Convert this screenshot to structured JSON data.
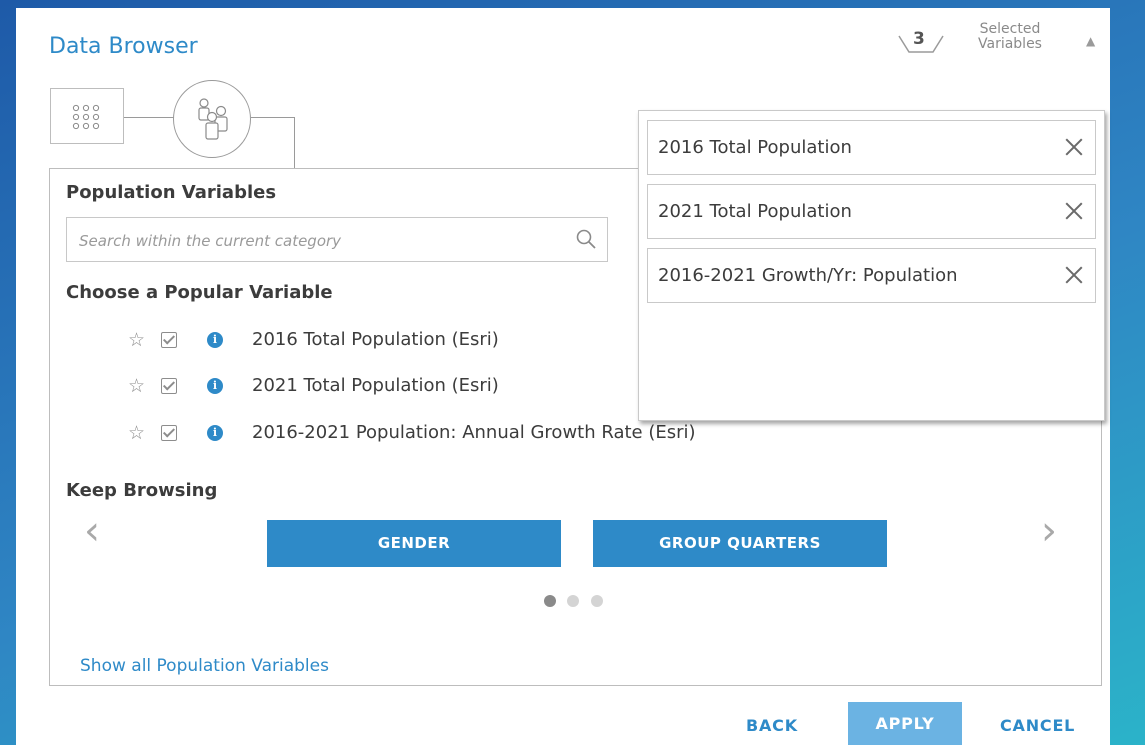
{
  "app": {
    "title": "Data Browser"
  },
  "selected": {
    "count": "3",
    "label": "Selected Variables",
    "caret": "▲"
  },
  "category": {
    "title": "Population Variables",
    "search_placeholder": "Search within the current category",
    "popular_heading": "Choose a Popular Variable",
    "variables": [
      {
        "label": "2016 Total Population (Esri)",
        "checked": true
      },
      {
        "label": "2021 Total Population (Esri)",
        "checked": true
      },
      {
        "label": "2016-2021 Population: Annual Growth Rate (Esri)",
        "checked": true
      }
    ],
    "keep_browsing_heading": "Keep Browsing",
    "browse_buttons": [
      "GENDER",
      "GROUP QUARTERS"
    ],
    "pager": {
      "pages": 3,
      "active": 1
    },
    "show_all_link": "Show all Population Variables"
  },
  "selected_list": [
    {
      "label": "2016 Total Population"
    },
    {
      "label": "2021 Total Population"
    },
    {
      "label": "2016-2021 Growth/Yr: Population"
    }
  ],
  "footer": {
    "back": "BACK",
    "apply": "APPLY",
    "cancel": "CANCEL"
  },
  "colors": {
    "accent": "#2e8ac8",
    "apply_disabled": "#6bb3e3"
  }
}
